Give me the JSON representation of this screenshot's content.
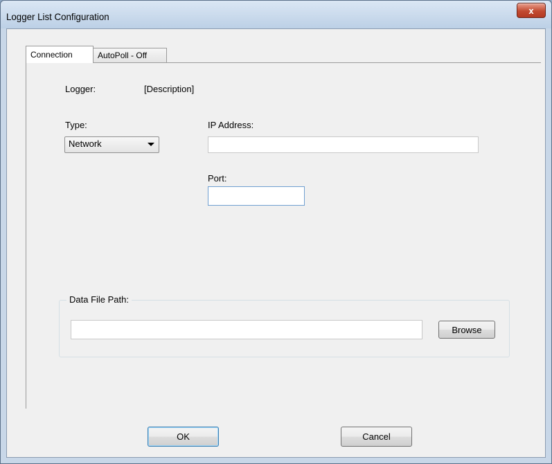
{
  "window": {
    "title": "Logger List Configuration",
    "close_glyph": "x"
  },
  "tabs": [
    {
      "label": "Connection",
      "active": true
    },
    {
      "label": "AutoPoll - Off",
      "active": false
    }
  ],
  "connection": {
    "logger_label": "Logger:",
    "logger_value": "[Description]",
    "type_label": "Type:",
    "type_selected": "Network",
    "ip_label": "IP Address:",
    "ip_value": "",
    "port_label": "Port:",
    "port_value": "",
    "data_file_group": "Data File Path:",
    "data_file_value": "",
    "browse_label": "Browse"
  },
  "buttons": {
    "ok_label": "OK",
    "cancel_label": "Cancel"
  },
  "colors": {
    "window_frame": "#c8d7e8",
    "close_button": "#c24a30",
    "focus_border": "#6f9fd0"
  }
}
